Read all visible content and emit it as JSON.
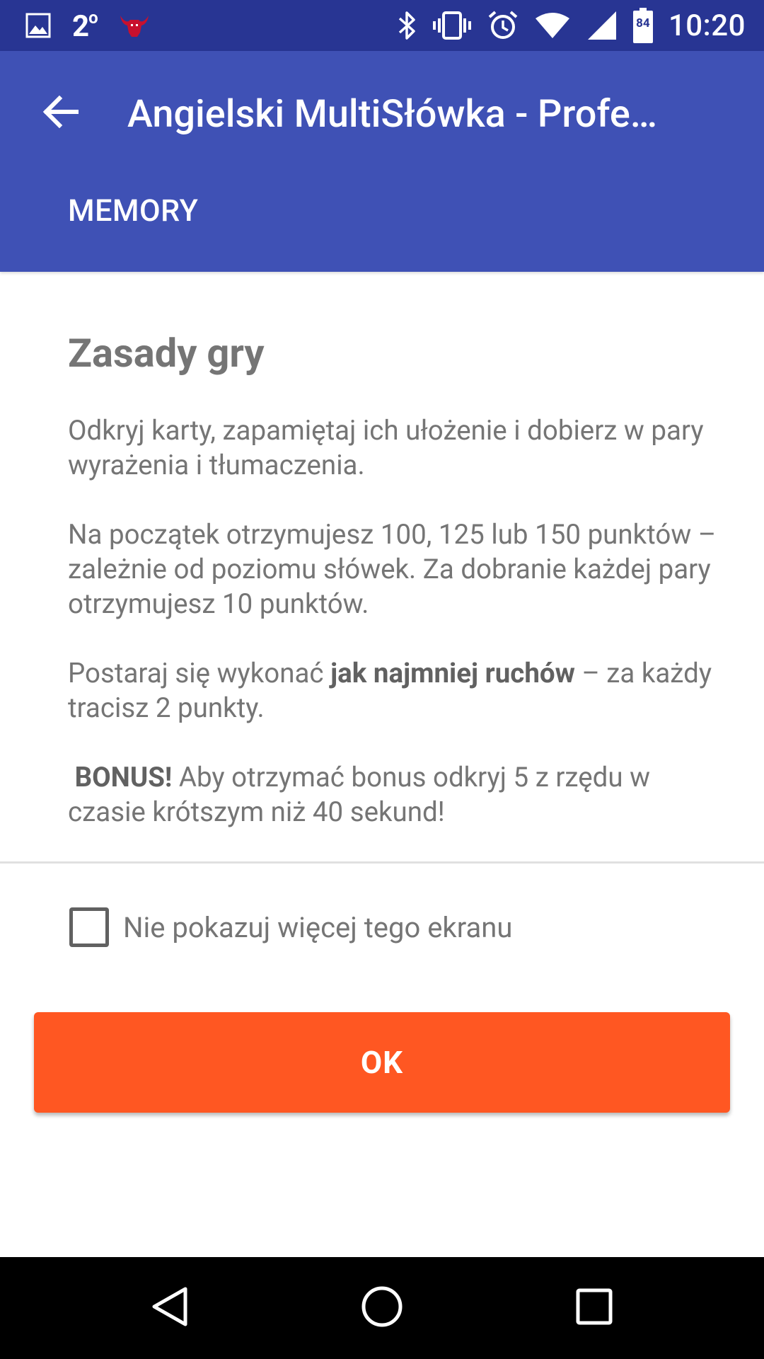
{
  "status_bar": {
    "temperature": "2",
    "temperature_unit": "o",
    "battery_level": "84",
    "time": "10:20",
    "icons": [
      "image-icon",
      "bulls-logo-icon",
      "bluetooth-icon",
      "vibrate-icon",
      "alarm-icon",
      "wifi-icon",
      "signal-icon",
      "battery-icon"
    ]
  },
  "app_bar": {
    "back_icon": "arrow-back-icon",
    "title": "Angielski MultiSłówka - Profe…",
    "tab_label": "MEMORY"
  },
  "rules": {
    "heading": "Zasady gry",
    "p1": "Odkryj karty, zapamiętaj ich ułożenie i dobierz w pary wyrażenia i tłumaczenia.",
    "p2": "Na początek otrzymujesz 100, 125 lub 150 punktów – zależnie od poziomu słówek. Za dobranie każdej pary otrzymujesz 10 punktów.",
    "p3_before": "Postaraj się wykonać ",
    "p3_bold": "jak najmniej ruchów",
    "p3_after": " – za każdy tracisz 2 punkty.",
    "p4_bold": "BONUS!",
    "p4_after": " Aby otrzymać bonus odkryj 5 z rzędu w czasie krótszym niż 40 sekund!"
  },
  "checkbox": {
    "label": "Nie pokazuj więcej tego ekranu",
    "checked": false
  },
  "ok_button": {
    "label": "OK"
  },
  "colors": {
    "status_bar": "#283593",
    "app_bar": "#3f51b5",
    "accent": "#ff5722",
    "text": "#757575"
  },
  "nav_bar": {
    "icons": [
      "nav-back-icon",
      "nav-home-icon",
      "nav-recents-icon"
    ]
  }
}
